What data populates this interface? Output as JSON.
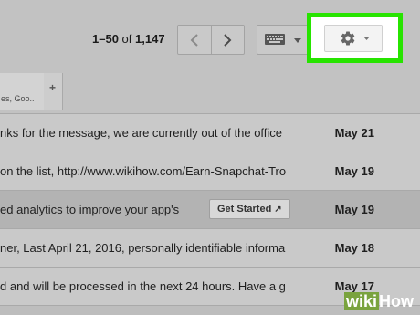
{
  "toolbar": {
    "range": "1–50",
    "of_word": "of",
    "total": "1,147",
    "prev_icon": "chevron-left-icon",
    "next_icon": "chevron-right-icon",
    "input_tools_icon": "keyboard-icon",
    "settings_icon": "gear-icon",
    "highlight_color": "#27e400"
  },
  "tabs": [
    {
      "label": "es, Goo.."
    }
  ],
  "add_tab_label": "+",
  "rows": [
    {
      "snippet": "nks for the message, we are currently out of the office",
      "date": "May 21",
      "unread": true
    },
    {
      "snippet": "on the list, http://www.wikihow.com/Earn-Snapchat-Tro",
      "date": "May 19",
      "unread": true
    },
    {
      "snippet": "ed analytics to improve your app's",
      "date": "May 19",
      "unread": false,
      "action_label": "Get Started",
      "action_icon": "external-link-icon"
    },
    {
      "snippet": "ner, Last April 21, 2016, personally identifiable informa",
      "date": "May 18",
      "unread": true
    },
    {
      "snippet": "d and will be processed in the next 24 hours. Have a g",
      "date": "May 17",
      "unread": true
    }
  ],
  "watermark": {
    "wiki": "wiki",
    "how": "How"
  }
}
